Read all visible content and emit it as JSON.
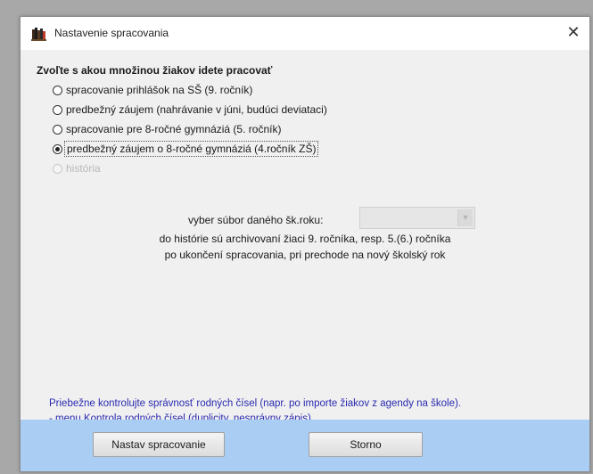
{
  "window": {
    "title": "Nastavenie spracovania",
    "close_symbol": "✕",
    "app_icon": "books-icon"
  },
  "question": "Zvoľte s akou množinou žiakov idete pracovať",
  "options": [
    {
      "label": "spracovanie prihlášok na SŠ (9. ročník)",
      "selected": false,
      "enabled": true
    },
    {
      "label": "predbežný záujem (nahrávanie v júni, budúci deviataci)",
      "selected": false,
      "enabled": true
    },
    {
      "label": "spracovanie pre 8-ročné gymnáziá (5. ročník)",
      "selected": false,
      "enabled": true
    },
    {
      "label": "predbežný záujem o 8-ročné gymnáziá (4.ročník ZŠ)",
      "selected": true,
      "enabled": true
    },
    {
      "label": "história",
      "selected": false,
      "enabled": false
    }
  ],
  "file": {
    "label": "vyber súbor daného šk.roku:",
    "value": ""
  },
  "note": {
    "line1": "do histórie sú archivovaní žiaci 9. ročníka, resp. 5.(6.) ročníka",
    "line2": "po ukončení spracovania, pri prechode na nový školský rok"
  },
  "hint": {
    "line1": "Priebežne kontrolujte správnosť rodných čísel (napr. po importe žiakov z agendy na škole).",
    "line2": "- menu Kontrola rodných čísel (duplicity, nesprávny zápis)."
  },
  "buttons": {
    "confirm": "Nastav spracovanie",
    "cancel": "Storno"
  },
  "colors": {
    "footer": "#a9cdf3",
    "hint_text": "#2a2ab0",
    "disabled_text": "#b8b8b8"
  }
}
